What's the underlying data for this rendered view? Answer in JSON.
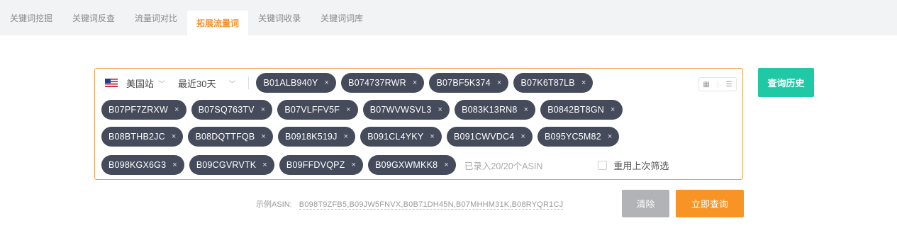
{
  "tabs": [
    {
      "label": "关键词挖掘",
      "active": false
    },
    {
      "label": "关键词反查",
      "active": false
    },
    {
      "label": "流量词对比",
      "active": false
    },
    {
      "label": "拓展流量词",
      "active": true
    },
    {
      "label": "关键词收录",
      "active": false
    },
    {
      "label": "关键词词库",
      "active": false
    }
  ],
  "filters": {
    "site": "美国站",
    "site_icon": "us-flag-icon",
    "period": "最近30天"
  },
  "asins": [
    "B01ALB940Y",
    "B074737RWR",
    "B07BF5K374",
    "B07K6T87LB",
    "B07PF7ZRXW",
    "B07SQ763TV",
    "B07VLFFV5F",
    "B07WVWSVL3",
    "B083K13RN8",
    "B0842BT8GN",
    "B08BTHB2JC",
    "B08DQTTFQB",
    "B0918K519J",
    "B091CL4YKY",
    "B091CWVDC4",
    "B095YC5M82",
    "B098KGX6G3",
    "B09CGVRVTK",
    "B09FFDVQPZ",
    "B09GXWMKK8"
  ],
  "chip_remove_glyph": "×",
  "asin_count_text": "已录入20/20个ASIN",
  "reuse_filter_label": "重用上次筛选",
  "reuse_filter_checked": false,
  "view_toggle": {
    "grid_icon": "grid-view-icon",
    "list_icon": "list-view-icon"
  },
  "buttons": {
    "history": "查询历史",
    "clear": "清除",
    "search": "立即查询"
  },
  "example": {
    "label": "示例ASIN:",
    "asins": "B098T9ZFB5,B09JW5FNVX,B0B71DH45N,B07MHHM31K,B08RYQR1CJ"
  },
  "colors": {
    "accent_orange": "#f79425",
    "history_green": "#1fc9a5",
    "chip_bg": "#454b5b",
    "box_border": "#f5a04a",
    "clear_gray": "#b1b3b6"
  }
}
